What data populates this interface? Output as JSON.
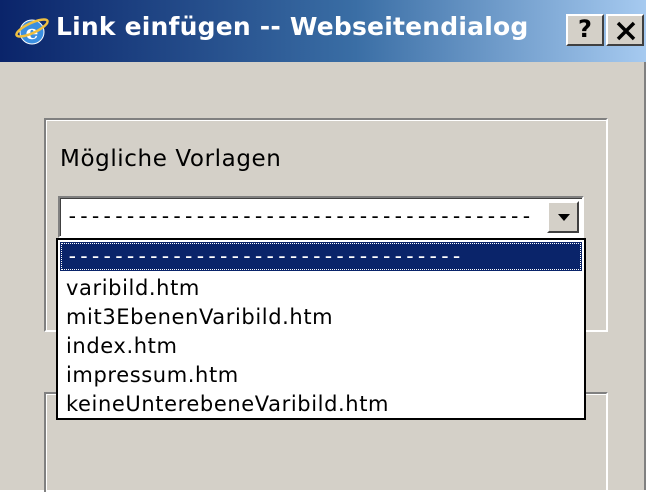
{
  "window": {
    "title": "Link einfügen -- Webseitendialog",
    "help_button": "?",
    "title_icon": "internet-explorer-icon",
    "close_icon": "close-icon"
  },
  "form": {
    "templates_label": "Mögliche Vorlagen",
    "select": {
      "value": "----------------------------------------",
      "options": [
        "----------------------------------",
        "varibild.htm",
        "mit3EbenenVaribild.htm",
        "index.htm",
        "impressum.htm",
        "keineUnterebeneVaribild.htm"
      ],
      "selected_index": 0
    }
  },
  "colors": {
    "titlebar_start": "#0a246a",
    "titlebar_end": "#a6caf0",
    "dialog_face": "#d4d0c8",
    "selection": "#0a246a"
  }
}
